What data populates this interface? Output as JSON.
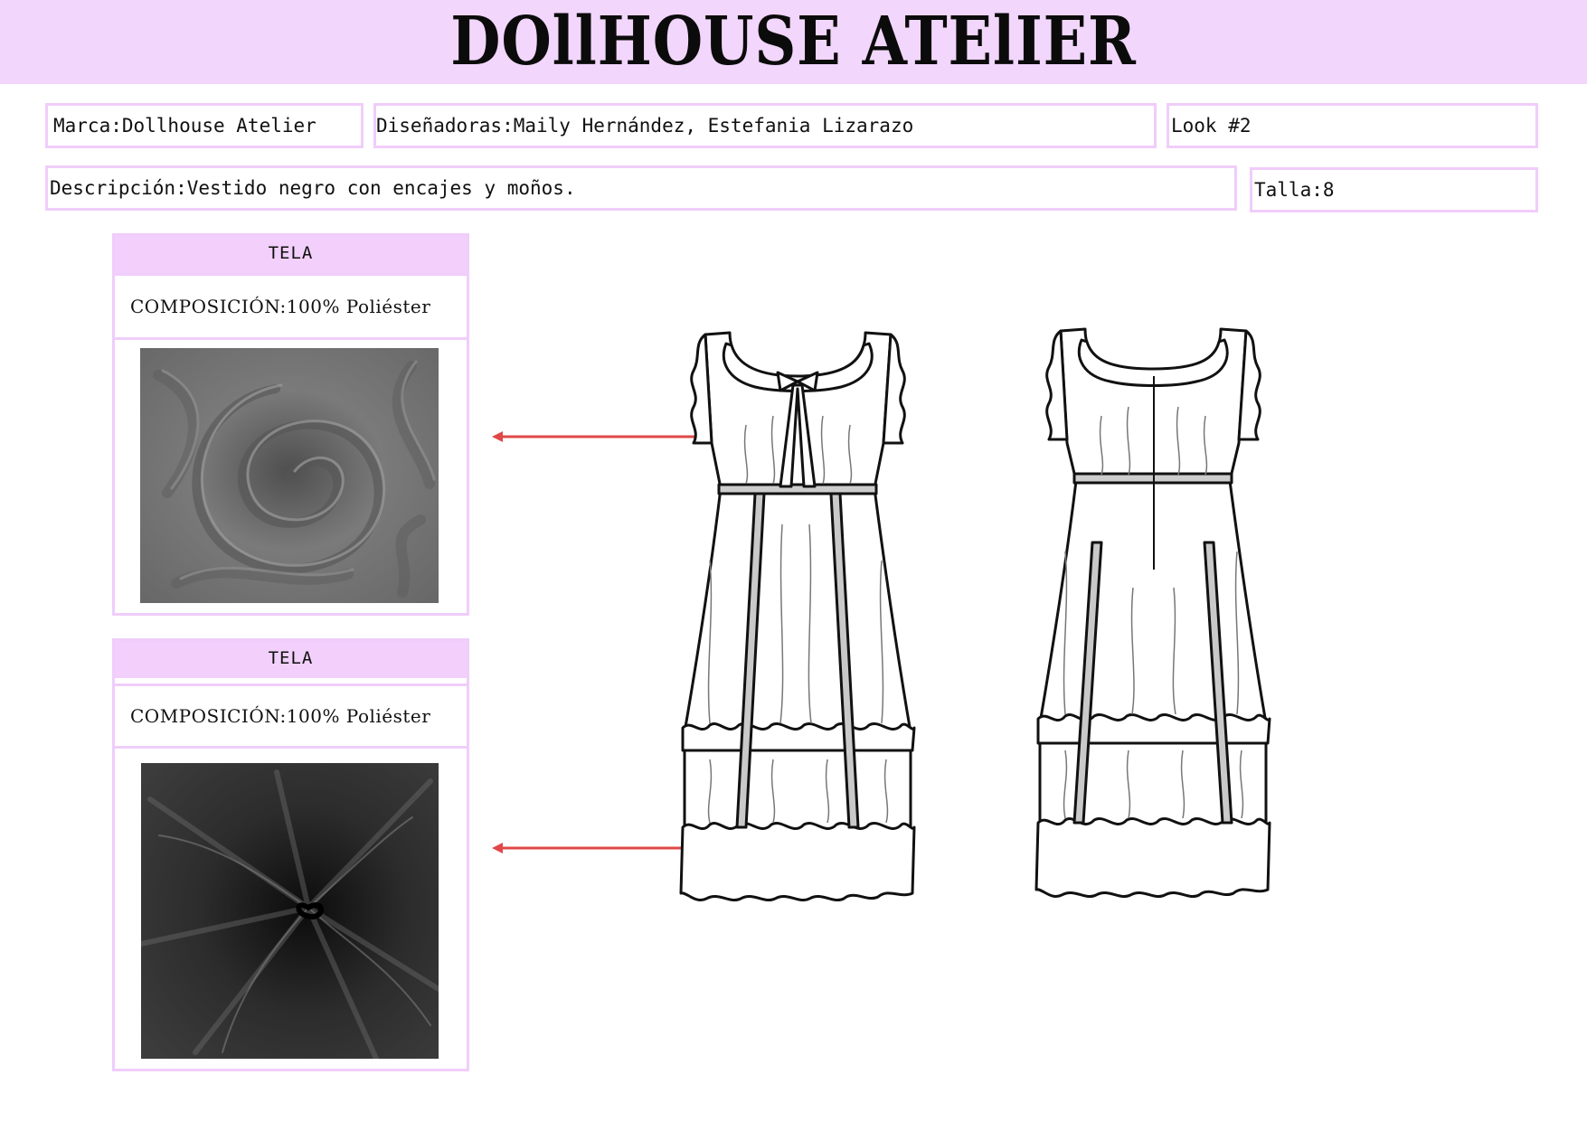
{
  "header": {
    "brand_title": "DOllHOUSE ATElIER",
    "background": "#f2d6fb"
  },
  "info": {
    "marca_label": "Marca:",
    "marca_value": "Dollhouse Atelier",
    "disenadoras_label": "Diseñadoras:",
    "disenadoras_value": "Maily Hernández, Estefania Lizarazo",
    "look": "Look #2",
    "descripcion_label": "Descripción: ",
    "descripcion_value": "Vestido negro con encajes y moños.",
    "talla_label": "Talla: ",
    "talla_value": "8"
  },
  "fabrics": [
    {
      "header": "TELA",
      "composition_label": "COMPOSICIÓN:",
      "composition_value": "100% Poliéster",
      "swatch_color": "#6e6e6e",
      "swatch_name": "grey-crepe-fabric-swatch"
    },
    {
      "header": "TELA",
      "composition_label": "COMPOSICIÓN:",
      "composition_value": "100% Poliéster",
      "swatch_color": "#2a2a2a",
      "swatch_name": "black-satin-fabric-swatch"
    }
  ],
  "colors": {
    "accent_border": "#f0cdfa",
    "arrow": "#e04848"
  },
  "sketches": {
    "front": "dress-front-sketch",
    "back": "dress-back-sketch"
  }
}
